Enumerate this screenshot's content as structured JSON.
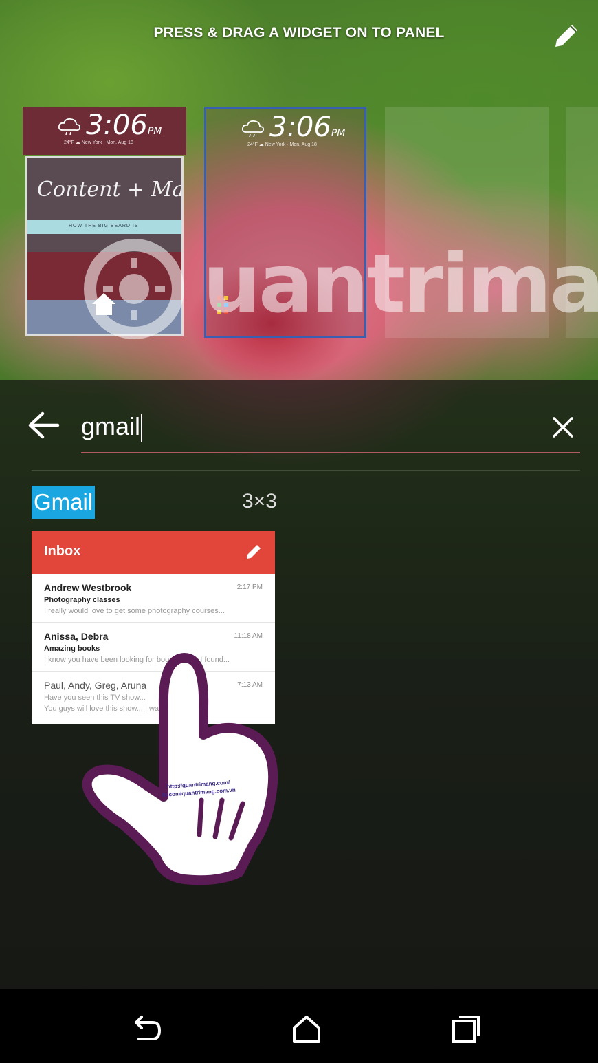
{
  "hint": {
    "text": "PRESS & DRAG A WIDGET ON TO PANEL"
  },
  "panels": {
    "clock_time": "3:06",
    "clock_ampm": "PM",
    "clock_date": "24°F ☁ New York · Mon, Aug 18",
    "content_title": "Content + Ma",
    "content_band": "HOW THE BIG BEARD IS"
  },
  "watermark": {
    "text": "uantrimang"
  },
  "search": {
    "query": "gmail"
  },
  "result": {
    "name": "Gmail",
    "size": "3×3",
    "widget": {
      "title": "Inbox",
      "emails": [
        {
          "sender": "Andrew Westbrook",
          "time": "2:17 PM",
          "subject": "Photography classes",
          "snippet": "I really would love to get some photography courses..."
        },
        {
          "sender": "Anissa, Debra",
          "time": "11:18 AM",
          "subject": "Amazing books",
          "snippet": "I know you have been looking for books lately. I found..."
        },
        {
          "sender": "Paul, Andy, Greg, Aruna",
          "time": "7:13 AM",
          "subject": "Have you seen this TV show...",
          "snippet": "You guys will love this show... I watched it..."
        }
      ]
    }
  },
  "hand_caption": {
    "line1": "http://quantrimang.com/",
    "line2": "fb.com/quantrimang.com.vn"
  },
  "colors": {
    "gmail_red": "#e2463b",
    "selection_blue": "#1aa6e0",
    "panel_border": "#3a5fb0"
  },
  "icons": [
    "pencil-icon",
    "cloud-icon",
    "back-arrow-icon",
    "close-icon",
    "compose-icon",
    "nav-back-icon",
    "nav-home-icon",
    "nav-recents-icon"
  ]
}
